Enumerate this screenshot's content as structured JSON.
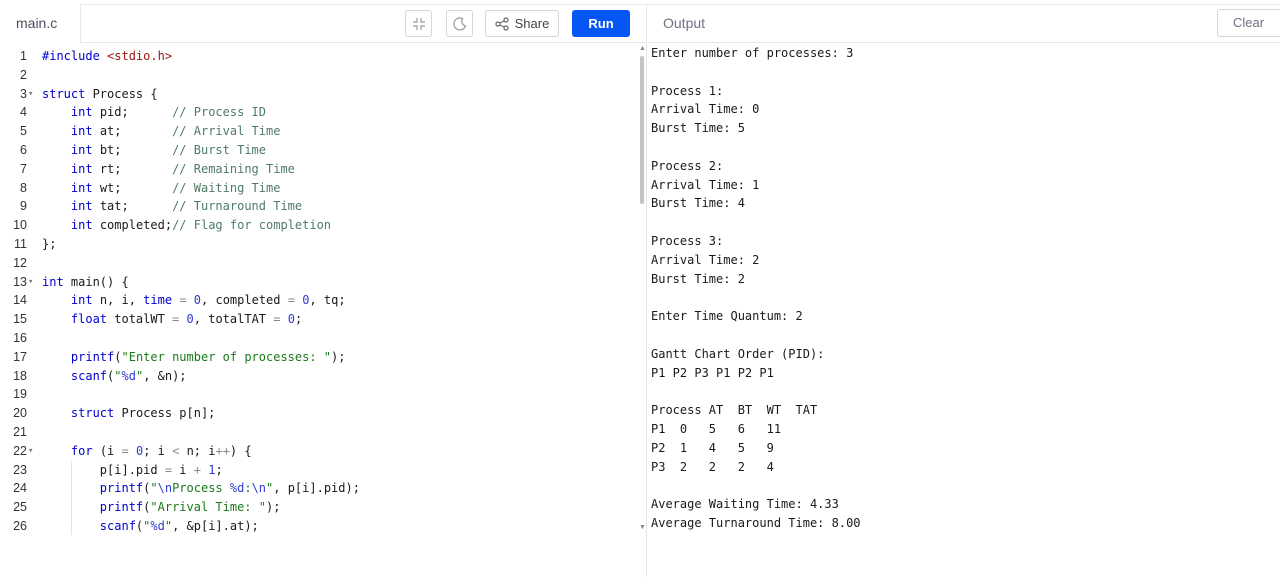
{
  "editor": {
    "file_tab": "main.c",
    "toolbar": {
      "share_label": "Share",
      "run_label": "Run"
    },
    "lines": [
      {
        "n": "1",
        "fold": false,
        "indent": 0,
        "html": "<span class='kw'>#include</span> <span class='inc'>&lt;stdio.h&gt;</span>"
      },
      {
        "n": "2",
        "fold": false,
        "indent": 0,
        "html": ""
      },
      {
        "n": "3",
        "fold": true,
        "indent": 0,
        "html": "<span class='kw'>struct</span> Process {"
      },
      {
        "n": "4",
        "fold": false,
        "indent": 1,
        "html": "    <span class='kw'>int</span> pid;      <span class='cm'>// Process ID</span>"
      },
      {
        "n": "5",
        "fold": false,
        "indent": 1,
        "html": "    <span class='kw'>int</span> at;       <span class='cm'>// Arrival Time</span>"
      },
      {
        "n": "6",
        "fold": false,
        "indent": 1,
        "html": "    <span class='kw'>int</span> bt;       <span class='cm'>// Burst Time</span>"
      },
      {
        "n": "7",
        "fold": false,
        "indent": 1,
        "html": "    <span class='kw'>int</span> rt;       <span class='cm'>// Remaining Time</span>"
      },
      {
        "n": "8",
        "fold": false,
        "indent": 1,
        "html": "    <span class='kw'>int</span> wt;       <span class='cm'>// Waiting Time</span>"
      },
      {
        "n": "9",
        "fold": false,
        "indent": 1,
        "html": "    <span class='kw'>int</span> tat;      <span class='cm'>// Turnaround Time</span>"
      },
      {
        "n": "10",
        "fold": false,
        "indent": 1,
        "html": "    <span class='kw'>int</span> completed;<span class='cm'>// Flag for completion</span>"
      },
      {
        "n": "11",
        "fold": false,
        "indent": 0,
        "html": "};"
      },
      {
        "n": "12",
        "fold": false,
        "indent": 0,
        "html": ""
      },
      {
        "n": "13",
        "fold": true,
        "indent": 0,
        "html": "<span class='kw'>int</span> main() {"
      },
      {
        "n": "14",
        "fold": false,
        "indent": 1,
        "html": "    <span class='kw'>int</span> n, i, <span class='kw'>time</span> <span class='op'>=</span> <span class='nm'>0</span>, completed <span class='op'>=</span> <span class='nm'>0</span>, tq;"
      },
      {
        "n": "15",
        "fold": false,
        "indent": 1,
        "html": "    <span class='kw'>float</span> totalWT <span class='op'>=</span> <span class='nm'>0</span>, totalTAT <span class='op'>=</span> <span class='nm'>0</span>;"
      },
      {
        "n": "16",
        "fold": false,
        "indent": 1,
        "html": ""
      },
      {
        "n": "17",
        "fold": false,
        "indent": 1,
        "html": "    <span class='kw'>printf</span>(<span class='st'>\"Enter number of processes: \"</span>);"
      },
      {
        "n": "18",
        "fold": false,
        "indent": 1,
        "html": "    <span class='kw'>scanf</span>(<span class='st'>\"<span class='nm'>%d</span>\"</span>, &amp;n);"
      },
      {
        "n": "19",
        "fold": false,
        "indent": 1,
        "html": ""
      },
      {
        "n": "20",
        "fold": false,
        "indent": 1,
        "html": "    <span class='kw'>struct</span> Process p[n];"
      },
      {
        "n": "21",
        "fold": false,
        "indent": 1,
        "html": ""
      },
      {
        "n": "22",
        "fold": true,
        "indent": 1,
        "html": "    <span class='kw'>for</span> (i <span class='op'>=</span> <span class='nm'>0</span>; i <span class='op'>&lt;</span> n; i<span class='op'>++</span>) {"
      },
      {
        "n": "23",
        "fold": false,
        "indent": 2,
        "html": "        p[i].pid <span class='op'>=</span> i <span class='op'>+</span> <span class='nm'>1</span>;"
      },
      {
        "n": "24",
        "fold": false,
        "indent": 2,
        "html": "        <span class='kw'>printf</span>(<span class='st'>\"<span class='nm'>\\n</span>Process <span class='nm'>%d</span>:<span class='nm'>\\n</span>\"</span>, p[i].pid);"
      },
      {
        "n": "25",
        "fold": false,
        "indent": 2,
        "html": "        <span class='kw'>printf</span>(<span class='st'>\"Arrival Time: \"</span>);"
      },
      {
        "n": "26",
        "fold": false,
        "indent": 2,
        "html": "        <span class='kw'>scanf</span>(<span class='st'>\"<span class='nm'>%d</span>\"</span>, &amp;p[i].at);"
      }
    ]
  },
  "output_panel": {
    "title": "Output",
    "clear_label": "Clear",
    "lines": [
      "Enter number of processes: 3",
      "",
      "Process 1:",
      "Arrival Time: 0",
      "Burst Time: 5",
      "",
      "Process 2:",
      "Arrival Time: 1",
      "Burst Time: 4",
      "",
      "Process 3:",
      "Arrival Time: 2",
      "Burst Time: 2",
      "",
      "Enter Time Quantum: 2",
      "",
      "Gantt Chart Order (PID):",
      "P1 P2 P3 P1 P2 P1",
      "",
      "Process AT  BT  WT  TAT",
      "P1  0   5   6   11",
      "P2  1   4   5   9",
      "P3  2   2   2   4",
      "",
      "Average Waiting Time: 4.33",
      "Average Turnaround Time: 8.00"
    ]
  },
  "colors": {
    "run_button": "#0556f3",
    "keyword": "#0000cc",
    "comment": "#4f7b67",
    "string": "#1a7a1a"
  }
}
